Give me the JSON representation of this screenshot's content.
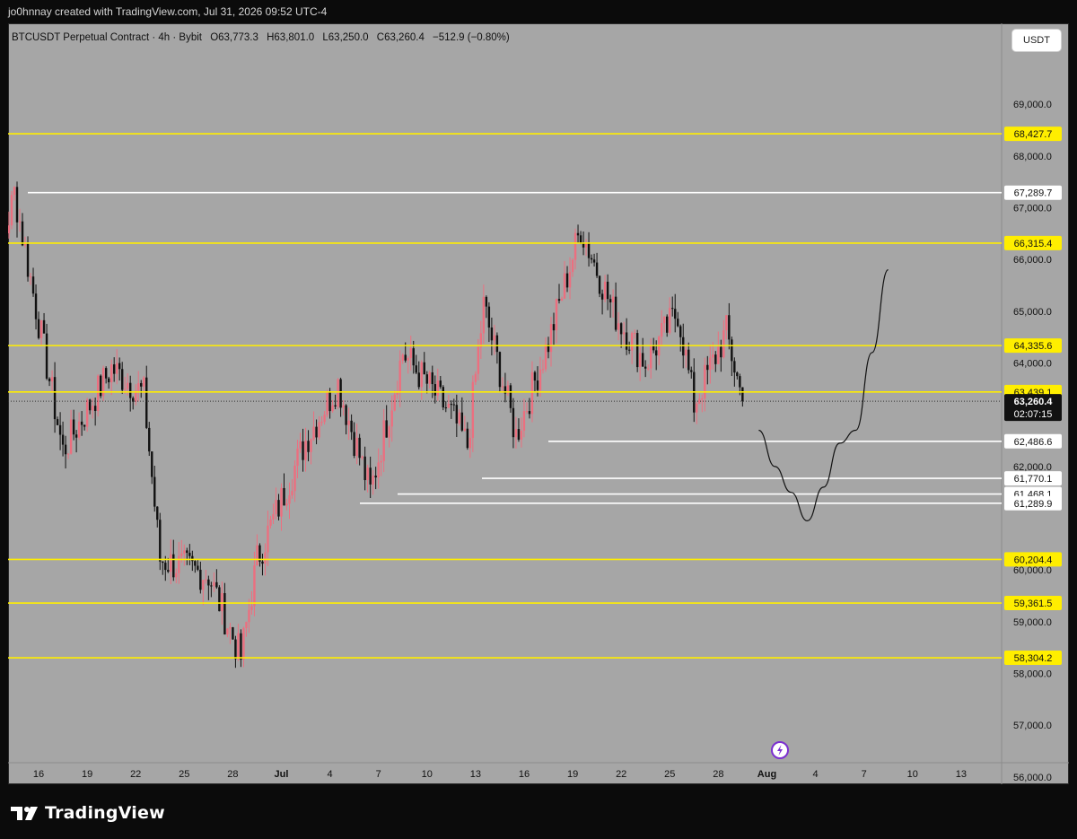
{
  "header": {
    "credit": "jo0hnnay created with TradingView.com, Jul 31, 2026 09:52 UTC-4"
  },
  "legend": {
    "symbol": "BTCUSDT Perpetual Contract · 4h · Bybit",
    "open": "O63,773.3",
    "high": "H63,801.0",
    "low": "L63,250.0",
    "close": "C63,260.4",
    "change": "−512.9 (−0.80%)"
  },
  "currency_button": "USDT",
  "footer": {
    "brand": "TradingView"
  },
  "colors": {
    "background": "#a6a6a6",
    "level_yellow": "#ffee00",
    "level_white": "#ffffff",
    "candle_up": "#ec6f7f",
    "candle_down": "#111111",
    "projection": "#111111",
    "alert_icon": "#7b2fd0"
  },
  "chart_data": {
    "type": "candlestick",
    "timeframe": "4h",
    "y_axis_ticks": [
      "69,000.0",
      "68,000.0",
      "67,000.0",
      "66,000.0",
      "65,000.0",
      "64,000.0",
      "62,000.0",
      "60,000.0",
      "59,000.0",
      "58,000.0",
      "57,000.0",
      "56,000.0"
    ],
    "y_tick_values": [
      69000,
      68000,
      67000,
      66000,
      65000,
      64000,
      62000,
      60000,
      59000,
      58000,
      57000,
      56000
    ],
    "x_axis_ticks": [
      "16",
      "19",
      "22",
      "25",
      "28",
      "Jul",
      "4",
      "7",
      "10",
      "13",
      "16",
      "19",
      "22",
      "25",
      "28",
      "Aug",
      "4",
      "7",
      "10",
      "13"
    ],
    "ylim": [
      55900,
      70000
    ],
    "yellow_levels": [
      {
        "value": 68427.7,
        "label": "68,427.7"
      },
      {
        "value": 66315.4,
        "label": "66,315.4"
      },
      {
        "value": 64335.6,
        "label": "64,335.6"
      },
      {
        "value": 63439.1,
        "label": "63,439.1"
      },
      {
        "value": 60204.4,
        "label": "60,204.4"
      },
      {
        "value": 59361.5,
        "label": "59,361.5"
      },
      {
        "value": 58304.2,
        "label": "58,304.2"
      }
    ],
    "white_levels": [
      {
        "value": 67289.7,
        "label": "67,289.7"
      },
      {
        "value": 62486.6,
        "label": "62,486.6"
      },
      {
        "value": 61770.1,
        "label": "61,770.1"
      },
      {
        "value": 61468.1,
        "label": "61,468.1"
      },
      {
        "value": 61289.9,
        "label": "61,289.9"
      }
    ],
    "current_price": {
      "value": 63260.4,
      "label": "63,260.4",
      "countdown": "02:07:15"
    },
    "key_closes": [
      {
        "date": "Jun 14",
        "close": 64400
      },
      {
        "date": "Jun 16",
        "close": 67290
      },
      {
        "date": "Jun 19",
        "close": 62300
      },
      {
        "date": "Jun 22",
        "close": 63900
      },
      {
        "date": "Jun 24",
        "close": 63400
      },
      {
        "date": "Jun 25",
        "close": 60200
      },
      {
        "date": "Jun 28",
        "close": 59900
      },
      {
        "date": "Jun 30",
        "close": 58300
      },
      {
        "date": "Jul 1",
        "close": 60200
      },
      {
        "date": "Jul 4",
        "close": 62500
      },
      {
        "date": "Jul 6",
        "close": 63600
      },
      {
        "date": "Jul 8",
        "close": 61500
      },
      {
        "date": "Jul 10",
        "close": 64200
      },
      {
        "date": "Jul 13",
        "close": 63000
      },
      {
        "date": "Jul 14",
        "close": 62400
      },
      {
        "date": "Jul 15",
        "close": 65100
      },
      {
        "date": "Jul 17",
        "close": 62600
      },
      {
        "date": "Jul 19",
        "close": 64400
      },
      {
        "date": "Jul 21",
        "close": 66600
      },
      {
        "date": "Jul 23",
        "close": 65000
      },
      {
        "date": "Jul 25",
        "close": 64000
      },
      {
        "date": "Jul 27",
        "close": 65000
      },
      {
        "date": "Jul 28",
        "close": 63200
      },
      {
        "date": "Jul 30",
        "close": 64600
      },
      {
        "date": "Jul 31",
        "close": 63260
      }
    ],
    "projection_path": [
      {
        "date": "Aug 1",
        "price": 62700
      },
      {
        "date": "Aug 2",
        "price": 62000
      },
      {
        "date": "Aug 3",
        "price": 61500
      },
      {
        "date": "Aug 4",
        "price": 60950
      },
      {
        "date": "Aug 5",
        "price": 61600
      },
      {
        "date": "Aug 6",
        "price": 62450
      },
      {
        "date": "Aug 7",
        "price": 62700
      },
      {
        "date": "Aug 8",
        "price": 64200
      },
      {
        "date": "Aug 9",
        "price": 65800
      }
    ]
  }
}
